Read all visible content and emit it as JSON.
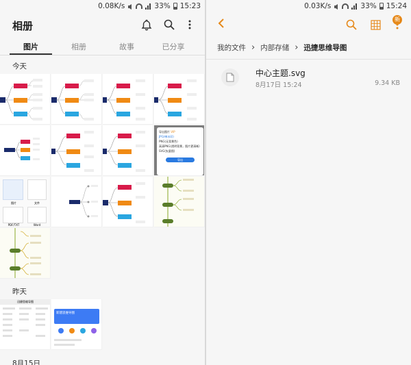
{
  "left": {
    "status": {
      "speed": "0.08K/s",
      "battery": "33%",
      "time": "15:23"
    },
    "title": "相册",
    "tabs": [
      "图片",
      "相册",
      "故事",
      "已分享"
    ],
    "sections": [
      "今天",
      "昨天",
      "8月15日"
    ],
    "dialog": {
      "title": "导出图片",
      "badge": "VIP",
      "options": [
        "JPG(带水印)",
        "PNG(无背景色)",
        "高清PNG(透明背景，图片更清晰)",
        "SVG(矢量图)"
      ],
      "button": "导出"
    },
    "chips": [
      "图片",
      "文件",
      "PDF/TXT",
      "Word"
    ],
    "yesterday_thumb": {
      "title": "迅捷思维导图",
      "banner": "新建思维导图"
    }
  },
  "right": {
    "status": {
      "speed": "0.03K/s",
      "battery": "33%",
      "time": "15:24"
    },
    "new_badge": "新",
    "breadcrumbs": [
      "我的文件",
      "内部存储",
      "迅捷思维导图"
    ],
    "file": {
      "name": "中心主题.svg",
      "date": "8月17日 15:24",
      "size": "9.34 KB"
    }
  },
  "colors": {
    "accent": "#e6891a",
    "mm_navy": "#1a2b6b",
    "mm_red": "#d81b4a",
    "mm_orange": "#f08a14",
    "mm_blue": "#2aa6e0"
  }
}
